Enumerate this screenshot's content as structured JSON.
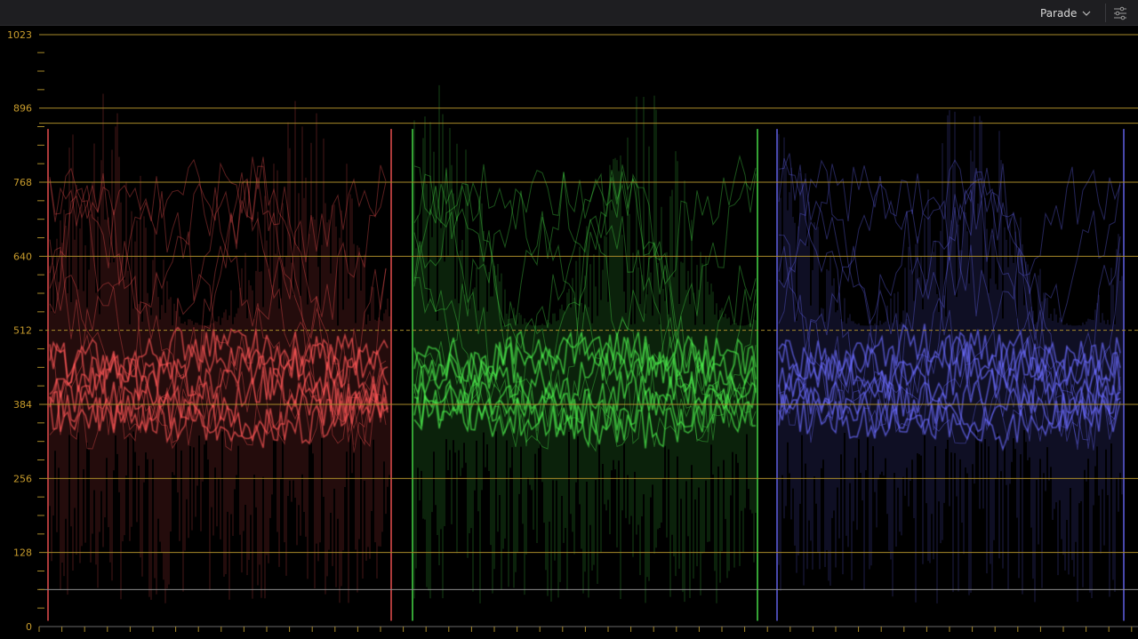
{
  "toolbar": {
    "mode": "Parade",
    "mode_icon": "chevron-down-icon",
    "settings_icon": "sliders-icon"
  },
  "scope": {
    "type": "parade-waveform",
    "axis_labels": [
      "1023",
      "896",
      "768",
      "640",
      "512",
      "384",
      "256",
      "128",
      "0"
    ],
    "axis_values": [
      1023,
      896,
      768,
      640,
      512,
      384,
      256,
      128,
      0
    ],
    "axis_range": [
      0,
      1023
    ],
    "midline_value": 512,
    "extra_guides": [
      870,
      64
    ],
    "channels": [
      {
        "name": "red",
        "color": "#ff5555"
      },
      {
        "name": "green",
        "color": "#4cf04c"
      },
      {
        "name": "blue",
        "color": "#6b6bff"
      }
    ],
    "colors": {
      "guide": "#a88a2a",
      "label": "#c89c2c",
      "extra_guide": "#8c8c8c"
    }
  }
}
